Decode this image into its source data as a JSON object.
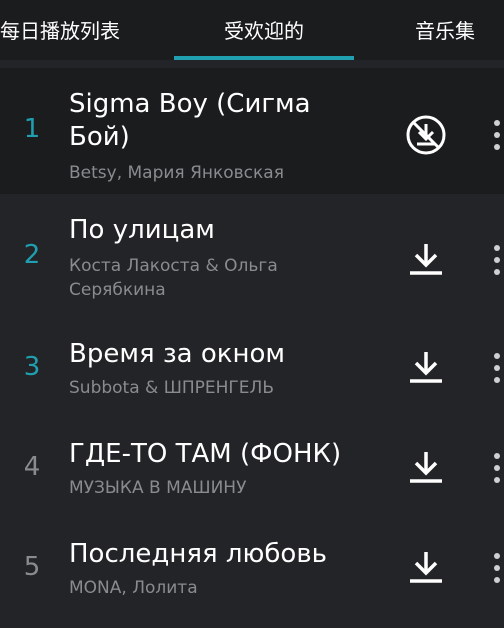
{
  "tabs": [
    {
      "label": "每日播放列表"
    },
    {
      "label": "受欢迎的"
    },
    {
      "label": "音乐集"
    }
  ],
  "active_tab": "受欢迎的",
  "colors": {
    "accent": "#1f9fb0",
    "background": "#232427",
    "highlight_row": "#1b1c1e",
    "primary_text": "#ffffff",
    "secondary_text": "#8a8b8f"
  },
  "songs": [
    {
      "rank": "1",
      "title": "Sigma Boy (Сигма Бой)",
      "artist": "Betsy, Мария Янковская",
      "download_icon": "download-disabled-icon"
    },
    {
      "rank": "2",
      "title": "По улицам",
      "artist": "Коста Лакоста  &  Ольга Серябкина",
      "download_icon": "download-icon"
    },
    {
      "rank": "3",
      "title": "Время за окном",
      "artist": "Subbota & ШПРЕНГЕЛЬ",
      "download_icon": "download-icon"
    },
    {
      "rank": "4",
      "title": "ГДЕ-ТО ТАМ (ФОНК)",
      "artist": "МУЗЫКА В МАШИНУ",
      "download_icon": "download-icon"
    },
    {
      "rank": "5",
      "title": "Последняя любовь",
      "artist": "MONA, Лолита",
      "download_icon": "download-icon"
    }
  ]
}
